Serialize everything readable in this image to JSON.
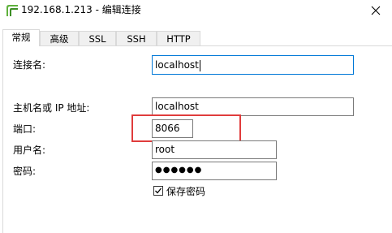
{
  "window": {
    "title": "192.168.1.213 - 编辑连接",
    "app_icon": "navicat-icon",
    "close_icon": "close-icon"
  },
  "tabs": [
    {
      "label": "常规",
      "active": true
    },
    {
      "label": "高级"
    },
    {
      "label": "SSL"
    },
    {
      "label": "SSH"
    },
    {
      "label": "HTTP"
    }
  ],
  "form": {
    "connection_name_label": "连接名:",
    "connection_name_value": "localhost",
    "host_label": "主机名或 IP 地址:",
    "host_value": "localhost",
    "port_label": "端口:",
    "port_value": "8066",
    "user_label": "用户名:",
    "user_value": "root",
    "password_label": "密码:",
    "password_value": "●●●●●●",
    "save_password_label": "保存密码",
    "save_password_checked": true
  },
  "colors": {
    "highlight_box": "#e03c3c",
    "focus_border": "#0078d7"
  }
}
